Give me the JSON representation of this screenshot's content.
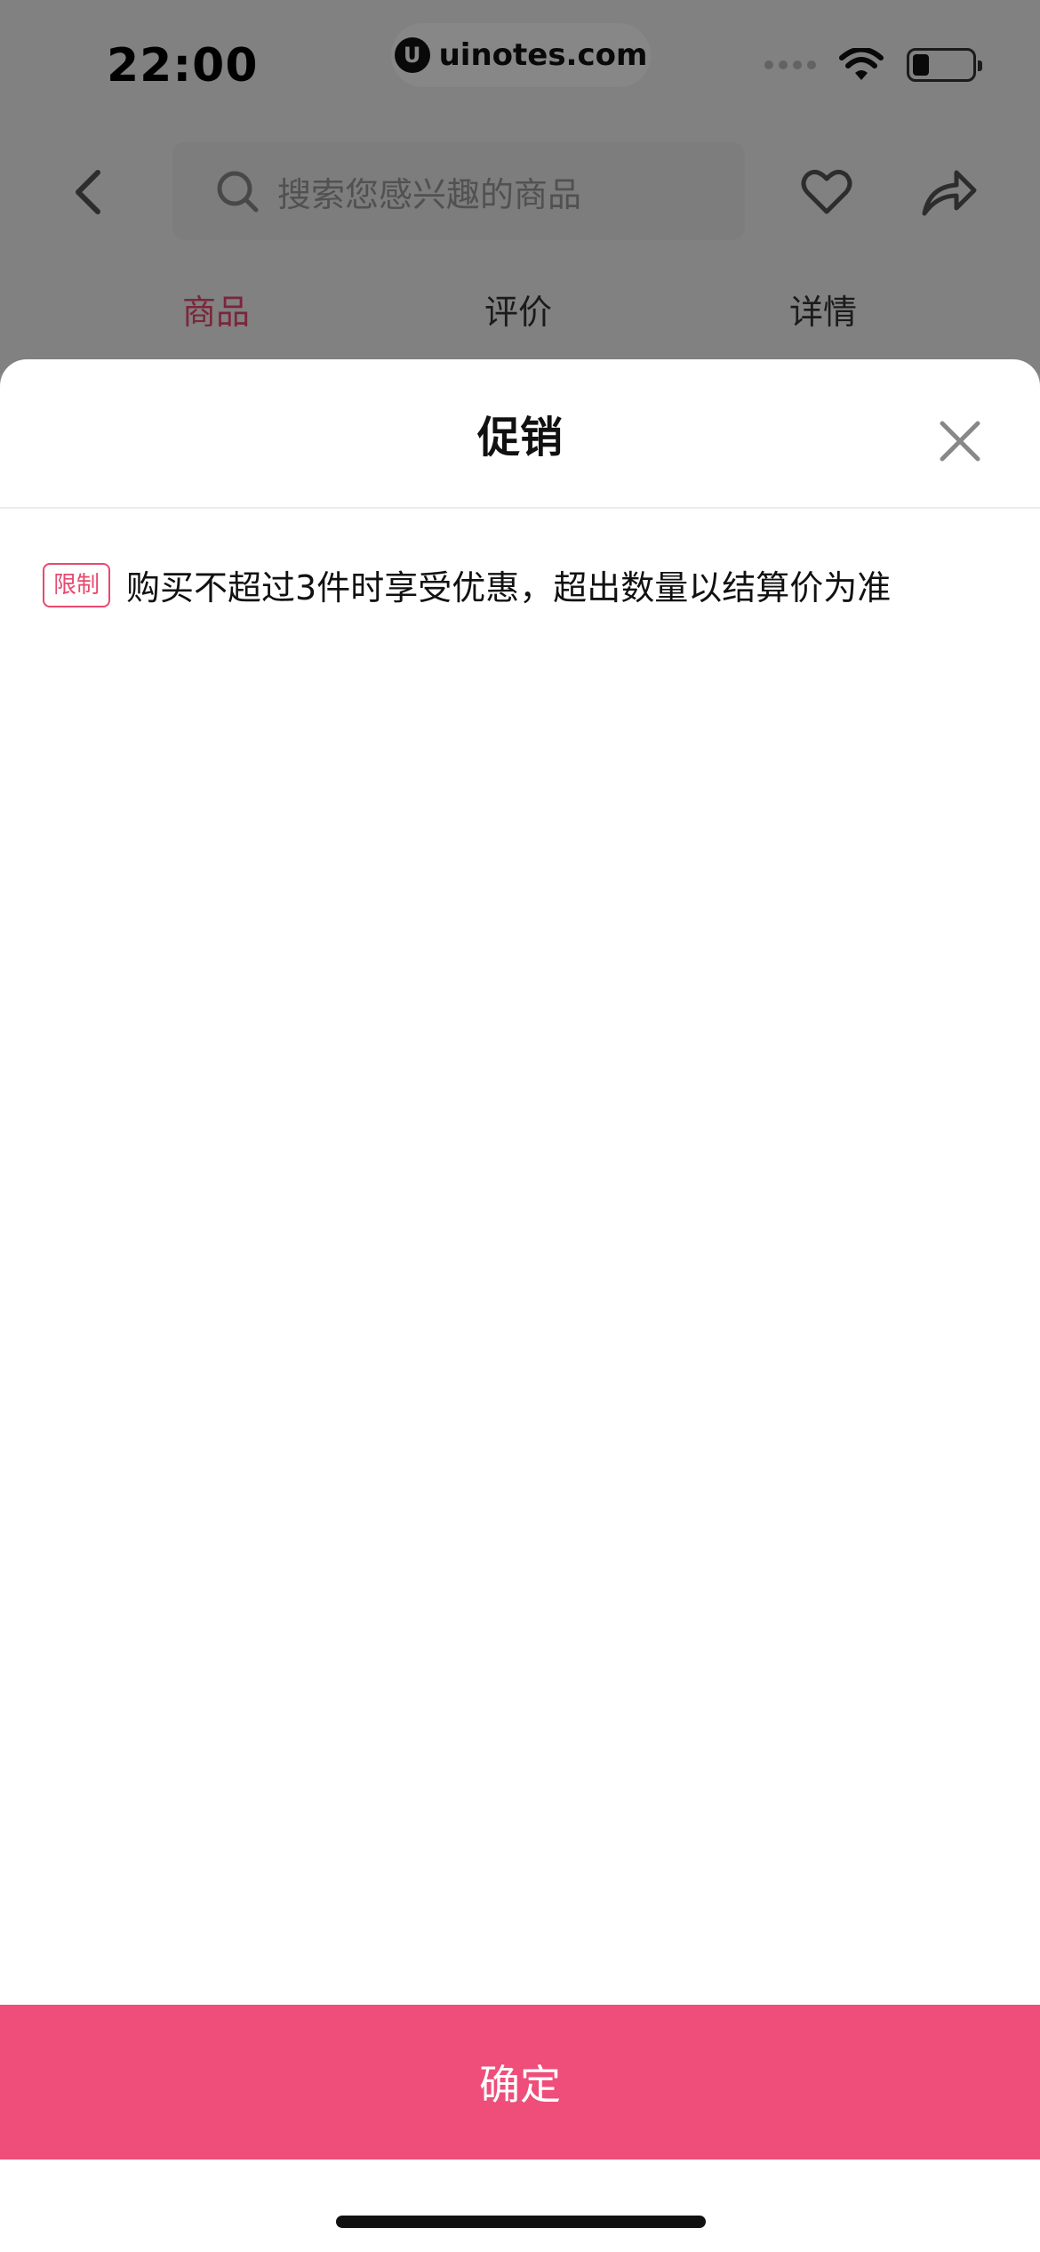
{
  "status_bar": {
    "time": "22:00",
    "url": "uinotes.com",
    "url_logo": "U"
  },
  "nav": {
    "search_placeholder": "搜索您感兴趣的商品",
    "icons": [
      "back-arrow-icon",
      "search-icon",
      "heart-icon",
      "share-icon"
    ]
  },
  "tabs": [
    {
      "label": "商品",
      "active": true
    },
    {
      "label": "评价",
      "active": false
    },
    {
      "label": "详情",
      "active": false
    }
  ],
  "sheet": {
    "title": "促销",
    "promotions": [
      {
        "badge": "限制",
        "text": "购买不超过3件时享受优惠，超出数量以结算价为准"
      }
    ],
    "confirm_label": "确定"
  },
  "colors": {
    "accent": "#e8496f",
    "confirm_bg": "#ee4e79",
    "overlay": "rgba(0,0,0,0.47)"
  }
}
